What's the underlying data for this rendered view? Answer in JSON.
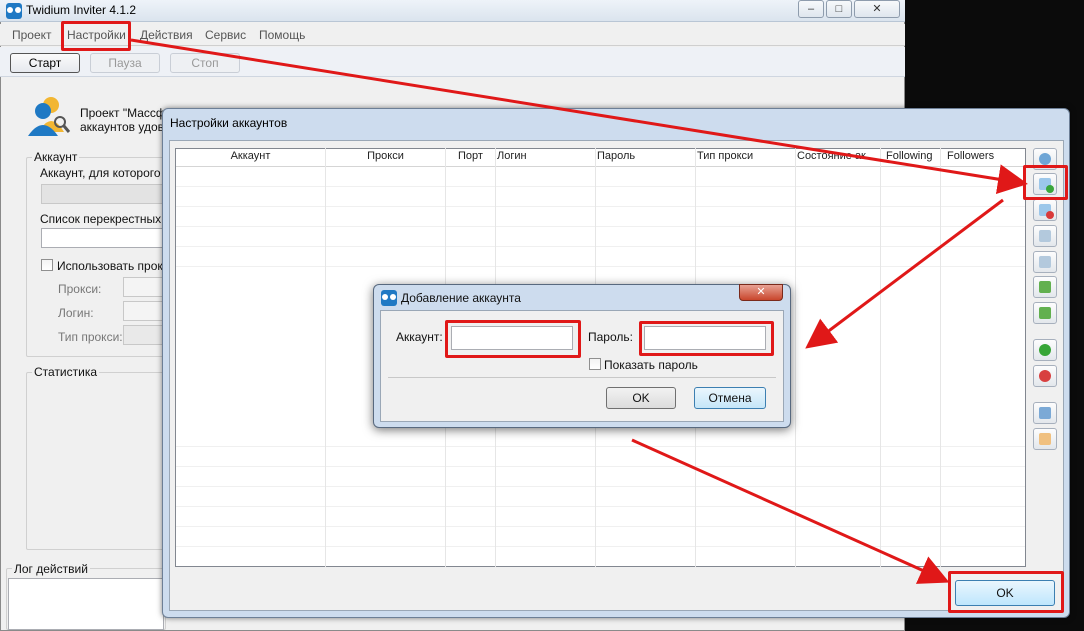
{
  "main_window": {
    "title": "Twidium Inviter 4.1.2",
    "menu": [
      "Проект",
      "Настройки",
      "Действия",
      "Сервис",
      "Помощь"
    ],
    "toolbar": {
      "start": "Старт",
      "pause": "Пауза",
      "stop": "Стоп"
    },
    "project_text_1": "Проект \"Массфо",
    "project_text_2": "аккаунтов удов",
    "account_group": {
      "title": "Аккаунт",
      "account_for_label": "Аккаунт, для которого",
      "cross_list_label": "Список перекрестных а",
      "use_proxy_label": "Использовать прокс",
      "proxy_label": "Прокси:",
      "login_label": "Логин:",
      "proxy_type_label": "Тип прокси:"
    },
    "stats_group_title": "Статистика",
    "log_title": "Лог действий"
  },
  "accounts_window": {
    "title": "Настройки аккаунтов",
    "columns": [
      "Аккаунт",
      "Прокси",
      "Порт",
      "Логин",
      "Пароль",
      "Тип прокси",
      "Состояние ак",
      "Following",
      "Followers"
    ],
    "ok_label": "OK"
  },
  "add_dialog": {
    "title": "Добавление аккаунта",
    "account_label": "Аккаунт:",
    "account_value": "",
    "password_label": "Пароль:",
    "password_value": "",
    "show_password_label": "Показать пароль",
    "ok_label": "OK",
    "cancel_label": "Отмена"
  },
  "colors": {
    "highlight": "#e01818",
    "accent": "#1f79c4"
  }
}
